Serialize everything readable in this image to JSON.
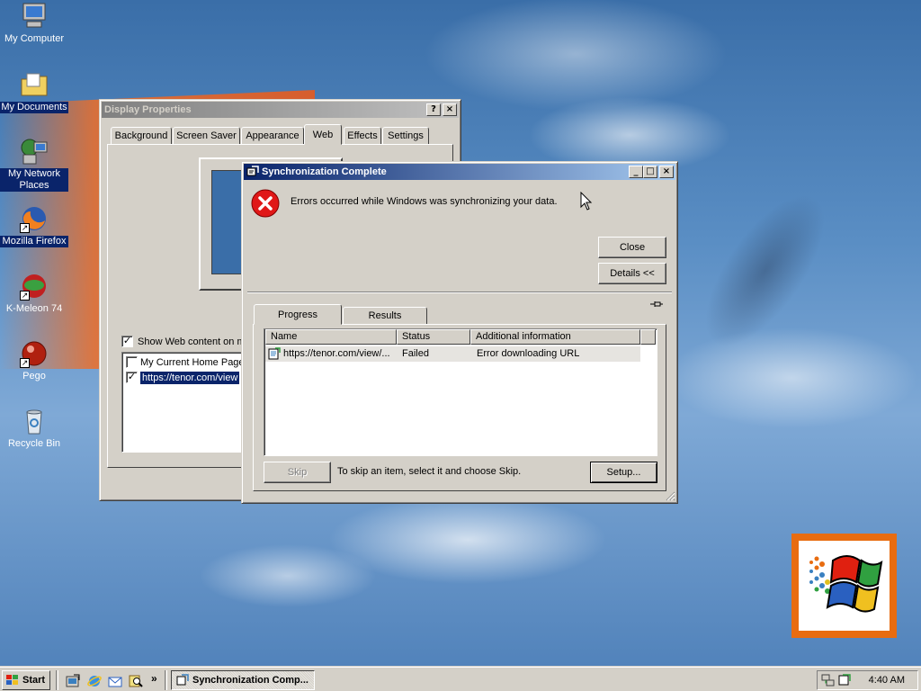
{
  "desktop": {
    "icons": [
      {
        "label": "My Computer",
        "icon": "computer-icon"
      },
      {
        "label": "My Documents",
        "icon": "folder-documents-icon"
      },
      {
        "label": "My Network Places",
        "icon": "network-places-icon"
      },
      {
        "label": "Mozilla Firefox",
        "icon": "firefox-icon"
      },
      {
        "label": "K-Meleon 74",
        "icon": "k-meleon-icon"
      },
      {
        "label": "Pego",
        "icon": "pego-icon"
      },
      {
        "label": "Recycle Bin",
        "icon": "recycle-bin-icon"
      }
    ]
  },
  "display_properties": {
    "title": "Display Properties",
    "help_btn": "?",
    "close_btn": "×",
    "tabs": [
      "Background",
      "Screen Saver",
      "Appearance",
      "Web",
      "Effects",
      "Settings"
    ],
    "selected_tab": "Web",
    "show_web_content": "Show Web content on m",
    "items": [
      {
        "label": "My Current Home Page",
        "checked": false
      },
      {
        "label": "https://tenor.com/view",
        "checked": true
      }
    ]
  },
  "sync_dialog": {
    "title": "Synchronization Complete",
    "message": "Errors occurred while Windows was synchronizing your data.",
    "close_label": "Close",
    "details_label": "Details <<",
    "tabs": [
      "Progress",
      "Results"
    ],
    "selected_tab": "Progress",
    "columns": [
      "Name",
      "Status",
      "Additional information"
    ],
    "rows": [
      {
        "name": "https://tenor.com/view/...",
        "status": "Failed",
        "info": "Error downloading URL"
      }
    ],
    "skip_label": "Skip",
    "skip_hint": "To skip an item, select it and choose Skip.",
    "setup_label": "Setup..."
  },
  "taskbar": {
    "start_label": "Start",
    "chevron": "»",
    "task_label": "Synchronization Comp...",
    "clock": "4:40 AM"
  },
  "colors": {
    "title_active_start": "#0a246a",
    "title_active_end": "#a6caf0",
    "face": "#d4d0c8",
    "error_red": "#e01818"
  }
}
